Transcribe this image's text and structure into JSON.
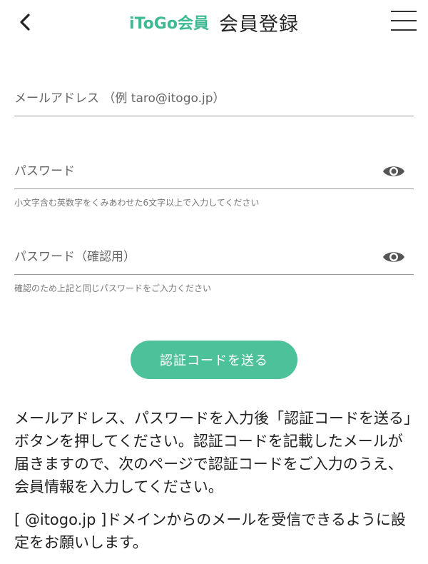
{
  "header": {
    "brand": "iToGo会員",
    "title": "会員登録"
  },
  "form": {
    "email": {
      "placeholder": "メールアドレス （例 taro@itogo.jp）",
      "value": ""
    },
    "password": {
      "placeholder": "パスワード",
      "value": "",
      "hint": "小文字含む英数字をくみあわせた6文字以上で入力してください"
    },
    "password_confirm": {
      "placeholder": "パスワード（確認用）",
      "value": "",
      "hint": "確認のため上記と同じパスワードをご入力ください"
    },
    "send_button_label": "認証コードを送る"
  },
  "instructions": {
    "paragraph1": "メールアドレス、パスワードを入力後「認証コードを送る」ボタンを押してください。認証コードを記載したメールが届きますので、次のページで認証コードをご入力のうえ、会員情報を入力してください。",
    "paragraph2": "[ @itogo.jp ]ドメインからのメールを受信できるように設定をお願いします。"
  },
  "icons": {
    "back": "chevron-left-icon",
    "menu": "hamburger-menu-icon",
    "eye": "eye-icon"
  },
  "colors": {
    "accent": "#3dba93",
    "button": "#4dc29a",
    "text": "#222222",
    "hint": "#777777"
  }
}
